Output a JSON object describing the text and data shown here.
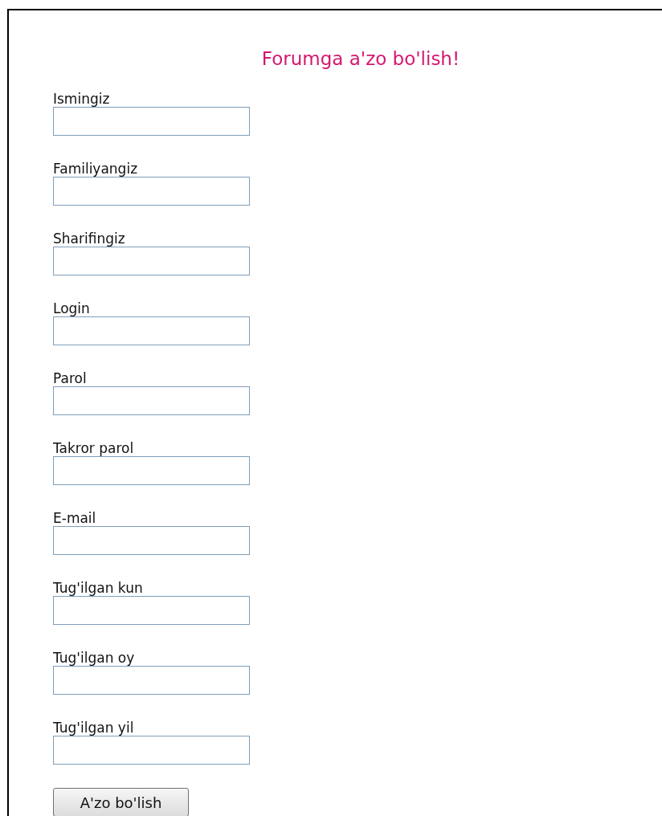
{
  "title": "Forumga a'zo bo'lish!",
  "fields": [
    {
      "label": "Ismingiz"
    },
    {
      "label": "Familiyangiz"
    },
    {
      "label": "Sharifingiz"
    },
    {
      "label": "Login"
    },
    {
      "label": "Parol"
    },
    {
      "label": "Takror parol"
    },
    {
      "label": "E-mail"
    },
    {
      "label": "Tug'ilgan kun"
    },
    {
      "label": "Tug'ilgan oy"
    },
    {
      "label": "Tug'ilgan yil"
    }
  ],
  "submit_button": "A'zo bo'lish"
}
